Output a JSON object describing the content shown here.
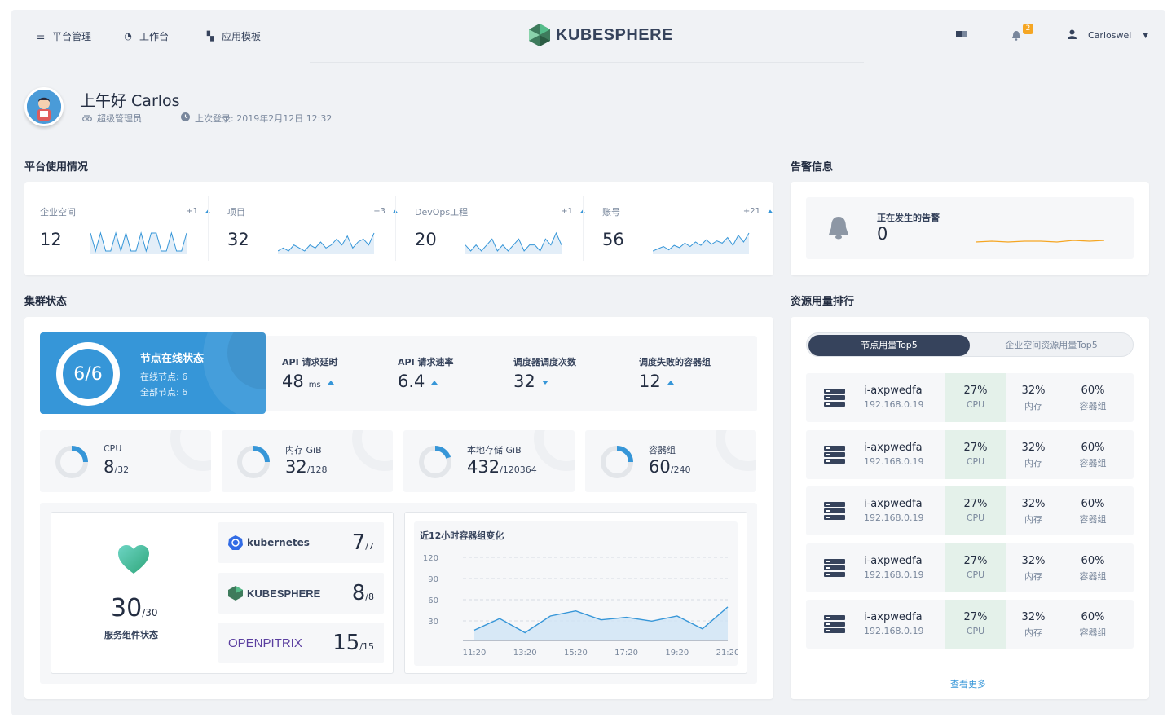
{
  "nav": {
    "items": [
      {
        "label": "平台管理",
        "icon": "list-icon"
      },
      {
        "label": "工作台",
        "icon": "dashboard-icon"
      },
      {
        "label": "应用模板",
        "icon": "grid-icon"
      }
    ],
    "logo_text": "KUBESPHERE",
    "notifications_count": "2",
    "username": "Carloswei"
  },
  "user": {
    "greeting": "上午好 Carlos",
    "role": "超级管理员",
    "last_login": "上次登录: 2019年2月12日 12:32"
  },
  "platform_usage": {
    "title": "平台使用情况",
    "stats": [
      {
        "label": "企业空间",
        "value": "12",
        "delta": "+1",
        "trend": [
          5,
          4,
          5,
          4,
          4,
          5,
          4,
          5,
          4,
          4,
          5,
          4,
          5,
          5,
          4,
          4,
          5,
          4,
          4,
          5
        ]
      },
      {
        "label": "项目",
        "value": "32",
        "delta": "+3",
        "trend": [
          4,
          5,
          4,
          6,
          5,
          4,
          6,
          5,
          7,
          5,
          6,
          8,
          6,
          9,
          5,
          7,
          8,
          6,
          10
        ]
      },
      {
        "label": "DevOps工程",
        "value": "20",
        "delta": "+1",
        "trend": [
          5,
          4,
          5,
          4,
          5,
          6,
          4,
          5,
          4,
          5,
          6,
          4,
          5,
          5,
          4,
          6,
          5,
          7,
          5
        ]
      },
      {
        "label": "账号",
        "value": "56",
        "delta": "+21",
        "trend": [
          4,
          6,
          8,
          5,
          9,
          7,
          11,
          8,
          12,
          9,
          14,
          10,
          13,
          11,
          16,
          9,
          18,
          12,
          20
        ]
      }
    ]
  },
  "alerts": {
    "title": "告警信息",
    "label": "正在发生的告警",
    "value": "0"
  },
  "cluster": {
    "title": "集群状态",
    "online": {
      "ring": "6/6",
      "title": "节点在线状态",
      "online_nodes": "在线节点: 6",
      "total_nodes": "全部节点: 6"
    },
    "api": [
      {
        "label": "API 请求延时",
        "value": "48",
        "unit": "ms",
        "dir": "up"
      },
      {
        "label": "API 请求速率",
        "value": "6.4",
        "unit": "",
        "dir": "up"
      },
      {
        "label": "调度器调度次数",
        "value": "32",
        "unit": "",
        "dir": "down"
      },
      {
        "label": "调度失败的容器组",
        "value": "12",
        "unit": "",
        "dir": "up"
      }
    ],
    "resources": [
      {
        "label": "CPU",
        "used": "8",
        "total": "/32",
        "fraction": 0.25
      },
      {
        "label": "内存 GiB",
        "used": "32",
        "total": "/128",
        "fraction": 0.25
      },
      {
        "label": "本地存储 GiB",
        "used": "432",
        "total": "/120364",
        "fraction": 0.2
      },
      {
        "label": "容器组",
        "used": "60",
        "total": "/240",
        "fraction": 0.25
      }
    ],
    "services": {
      "count": "30",
      "total": "/30",
      "label": "服务组件状态",
      "items": [
        {
          "name": "kubernetes",
          "count": "7",
          "total": "/7"
        },
        {
          "name": "KUBESPHERE",
          "count": "8",
          "total": "/8"
        },
        {
          "name": "OPENPITRIX",
          "count": "15",
          "total": "/15"
        }
      ]
    }
  },
  "chart_data": {
    "type": "area",
    "title": "近12小时容器组变化",
    "x": [
      "11:20",
      "12:20",
      "13:20",
      "14:20",
      "15:20",
      "16:20",
      "17:20",
      "18:20",
      "19:20",
      "20:20",
      "21:20"
    ],
    "categories_shown": [
      "11:20",
      "13:20",
      "15:20",
      "17:20",
      "19:20",
      "21:20"
    ],
    "values": [
      16,
      34,
      12,
      38,
      46,
      32,
      36,
      30,
      38,
      18,
      52
    ],
    "yticks": [
      120,
      90,
      60,
      30
    ],
    "ylim": [
      0,
      120
    ],
    "color": "#3696d8"
  },
  "ranking": {
    "title": "资源用量排行",
    "tabs": [
      "节点用量Top5",
      "企业空间资源用量Top5"
    ],
    "rows": [
      {
        "name": "i-axpwedfa",
        "ip": "192.168.0.19",
        "cpu": "27%",
        "cpu_label": "CPU",
        "mem": "32%",
        "mem_label": "内存",
        "pods": "60%",
        "pods_label": "容器组"
      },
      {
        "name": "i-axpwedfa",
        "ip": "192.168.0.19",
        "cpu": "27%",
        "cpu_label": "CPU",
        "mem": "32%",
        "mem_label": "内存",
        "pods": "60%",
        "pods_label": "容器组"
      },
      {
        "name": "i-axpwedfa",
        "ip": "192.168.0.19",
        "cpu": "27%",
        "cpu_label": "CPU",
        "mem": "32%",
        "mem_label": "内存",
        "pods": "60%",
        "pods_label": "容器组"
      },
      {
        "name": "i-axpwedfa",
        "ip": "192.168.0.19",
        "cpu": "27%",
        "cpu_label": "CPU",
        "mem": "32%",
        "mem_label": "内存",
        "pods": "60%",
        "pods_label": "容器组"
      },
      {
        "name": "i-axpwedfa",
        "ip": "192.168.0.19",
        "cpu": "27%",
        "cpu_label": "CPU",
        "mem": "32%",
        "mem_label": "内存",
        "pods": "60%",
        "pods_label": "容器组"
      }
    ],
    "more": "查看更多"
  },
  "colors": {
    "accent": "#3696d8",
    "dark": "#36435c",
    "alert_line": "#f5a623",
    "highlight": "#e4f1ea"
  }
}
